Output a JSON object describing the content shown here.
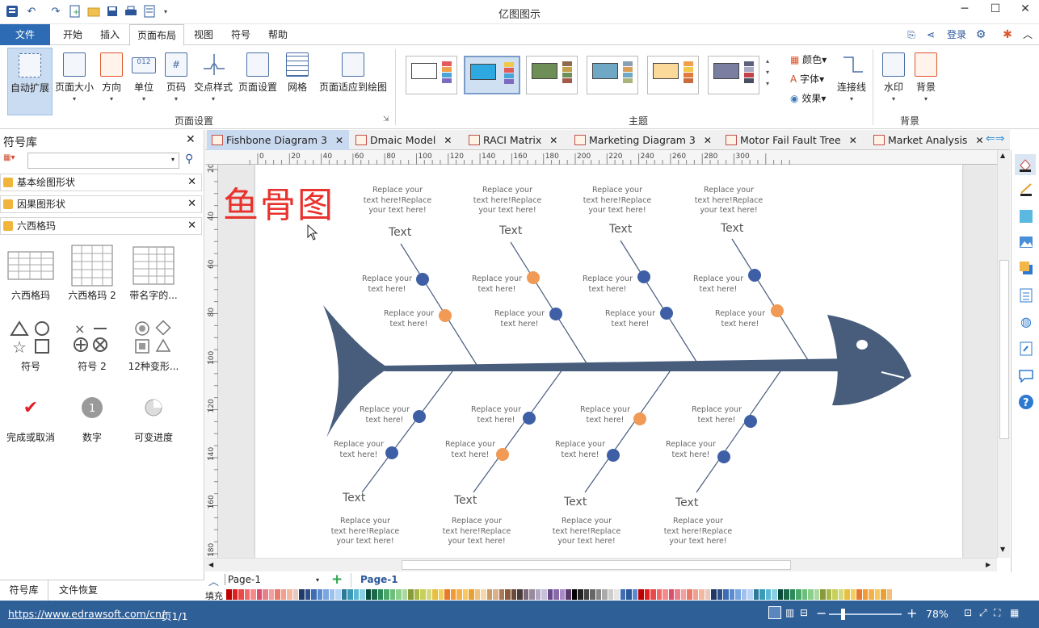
{
  "window": {
    "title": "亿图图示"
  },
  "menu": {
    "file": "文件",
    "items": [
      "开始",
      "插入",
      "页面布局",
      "视图",
      "符号",
      "帮助"
    ],
    "active": "页面布局",
    "login": "登录"
  },
  "ribbon": {
    "page_setup_buttons": [
      "自动扩展",
      "页面大小",
      "方向",
      "单位",
      "页码",
      "交点样式",
      "页面设置",
      "网格",
      "页面适应到绘图"
    ],
    "page_setup_group": "页面设置",
    "theme_group": "主题",
    "theme_options": [
      "颜色",
      "字体",
      "效果"
    ],
    "connector_label": "连接线",
    "background_buttons": [
      "水印",
      "背景"
    ],
    "background_group": "背景"
  },
  "left_panel": {
    "title": "符号库",
    "search_placeholder": "",
    "libraries": [
      "基本绘图形状",
      "因果图形状",
      "六西格玛"
    ],
    "shapes": [
      "六西格玛",
      "六西格玛 2",
      "带名字的...",
      "符号",
      "符号 2",
      "12种变形...",
      "完成或取消",
      "数字",
      "可变进度"
    ],
    "bottom_tabs": [
      "符号库",
      "文件恢复"
    ]
  },
  "tabs": [
    "Fishbone Diagram 3",
    "Dmaic Model",
    "RACI Matrix",
    "Marketing Diagram 3",
    "Motor Fail Fault Tree",
    "Market Analysis"
  ],
  "active_tab": "Fishbone Diagram 3",
  "ruler": {
    "h": [
      "0",
      "20",
      "40",
      "60",
      "80",
      "100",
      "120",
      "140",
      "160",
      "180",
      "200",
      "220",
      "240",
      "260",
      "280",
      "300"
    ],
    "v": [
      "20",
      "40",
      "60",
      "80",
      "100",
      "120",
      "140",
      "160",
      "180"
    ]
  },
  "diagram": {
    "heading": "鱼骨图",
    "placeholder_long": [
      "Replace your",
      "text here!Replace",
      "your text here!"
    ],
    "placeholder_short": [
      "Replace your",
      "text here!"
    ],
    "branch_label": "Text",
    "colors": {
      "fish": "#485d7c",
      "blue_dot": "#3e5fa6",
      "orange_dot": "#f09a55",
      "heading": "#e8322d"
    }
  },
  "pagebar": {
    "page_select": "Page-1",
    "page_tab": "Page-1"
  },
  "palette_label": "填充",
  "status": {
    "url": "https://www.edrawsoft.com/cn/",
    "page": "页1/1",
    "zoom": "78%"
  }
}
